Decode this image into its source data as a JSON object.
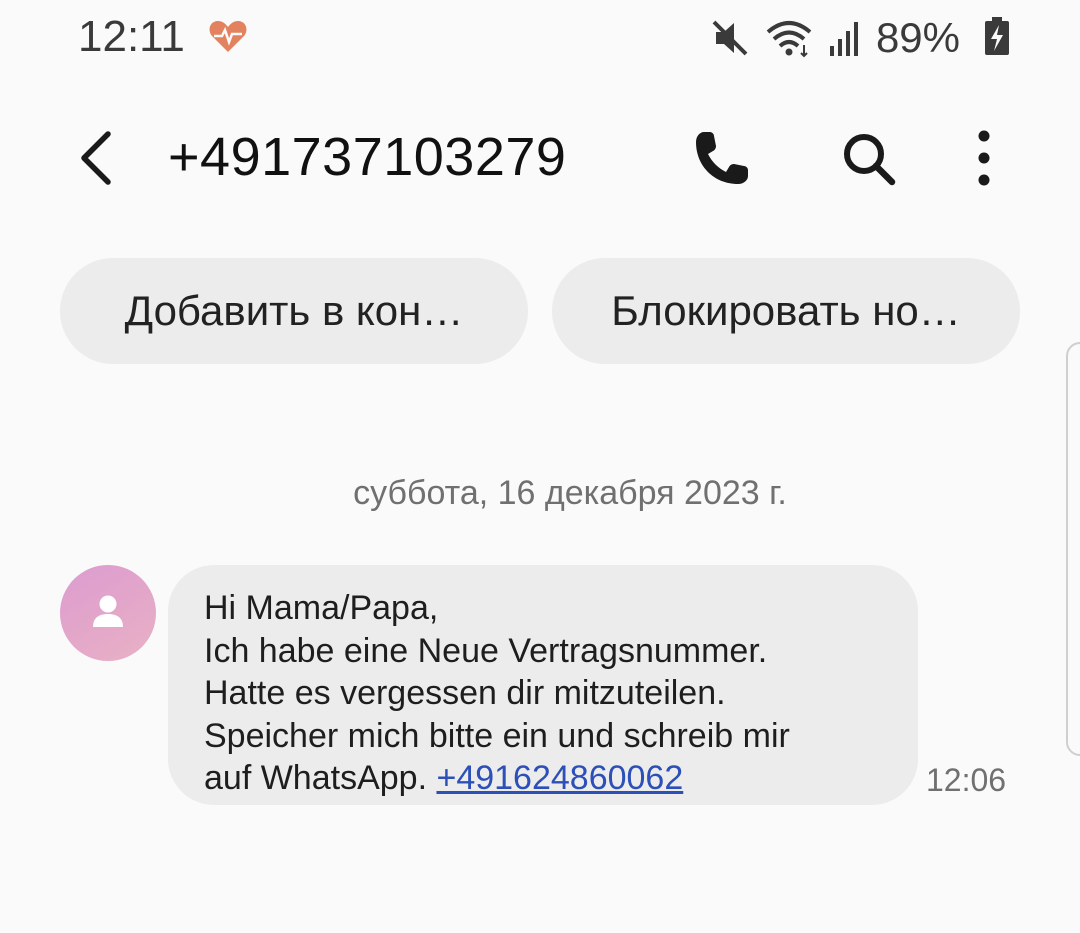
{
  "status_bar": {
    "time": "12:11",
    "battery_percent": "89%",
    "icons": [
      "heart-icon",
      "mute-icon",
      "wifi-icon",
      "signal-icon",
      "battery-charging-icon"
    ],
    "heart_color": "#e2825e"
  },
  "header": {
    "title": "+491737103279",
    "icons": [
      "back-icon",
      "phone-icon",
      "search-icon",
      "more-vertical-icon"
    ]
  },
  "chips": {
    "add_contact": "Добавить в кон…",
    "block_number": "Блокировать но…"
  },
  "conversation": {
    "date": "суббота, 16 декабря 2023 г.",
    "messages": [
      {
        "lines": [
          "Hi Mama/Papa,",
          "Ich habe eine Neue Vertragsnummer.",
          "Hatte es vergessen dir mitzuteilen.",
          "Speicher mich bitte ein und schreib mir"
        ],
        "last_line_text": "auf WhatsApp. ",
        "link": "+491624860062",
        "time": "12:06",
        "link_color": "#2c4fb8"
      }
    ]
  }
}
